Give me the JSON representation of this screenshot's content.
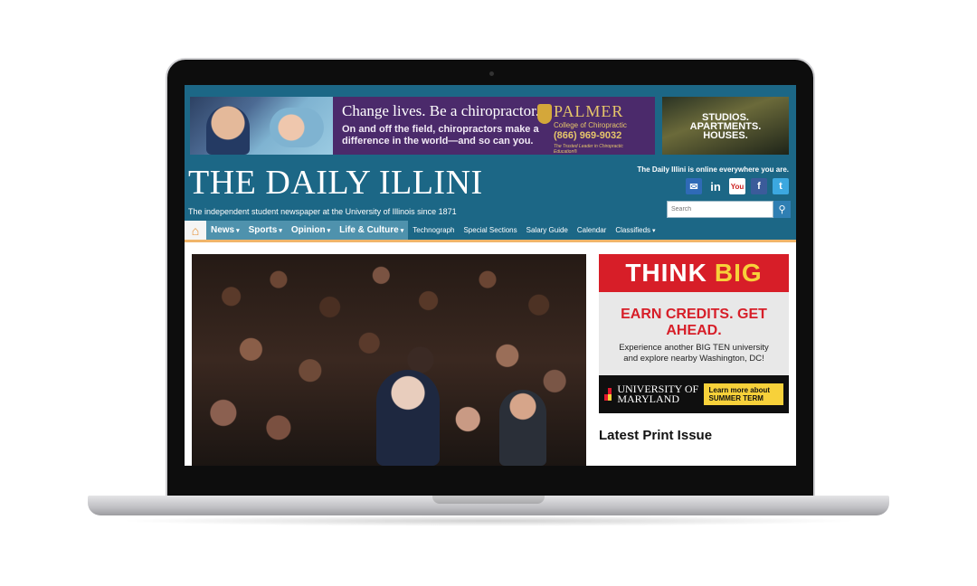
{
  "ads": {
    "palmer": {
      "headline": "Change lives.  Be a chiropractor.",
      "body": "On and off the field, chiropractors make a difference in the world—and so can you.",
      "brand": "PALMER",
      "brand_sub": "College of Chiropractic",
      "phone": "(866) 969-9032",
      "tagline": "The Trusted Leader in Chiropractic Education®"
    },
    "studios": {
      "line1": "STUDIOS.",
      "line2": "APARTMENTS.",
      "line3": "HOUSES."
    },
    "sidebar": {
      "think": "THINK",
      "big": "BIG",
      "headline": "EARN CREDITS. GET AHEAD.",
      "line1": "Experience another BIG TEN university",
      "line2": "and explore nearby Washington, DC!",
      "university": "UNIVERSITY OF MARYLAND",
      "cta": "Learn more about SUMMER TERM"
    }
  },
  "masthead": {
    "title": "THE DAILY ILLINI",
    "tagline": "The independent student newspaper at the University of Illinois since 1871",
    "online_text": "The Daily Illini is online everywhere you are.",
    "social": [
      "mail-icon",
      "linkedin-icon",
      "youtube-icon",
      "facebook-icon",
      "twitter-icon"
    ],
    "search_placeholder": "Search"
  },
  "nav": {
    "home_icon": "home-icon",
    "main": [
      "News",
      "Sports",
      "Opinion",
      "Life & Culture"
    ],
    "secondary": [
      "Technograph",
      "Special Sections",
      "Salary Guide",
      "Calendar",
      "Classifieds"
    ]
  },
  "sidebar": {
    "print_title": "Latest Print Issue"
  },
  "colors": {
    "brand_teal": "#1c6786",
    "nav_active": "#4f92ad",
    "accent_orange": "#f0b56a",
    "ad_red": "#d71e28"
  }
}
